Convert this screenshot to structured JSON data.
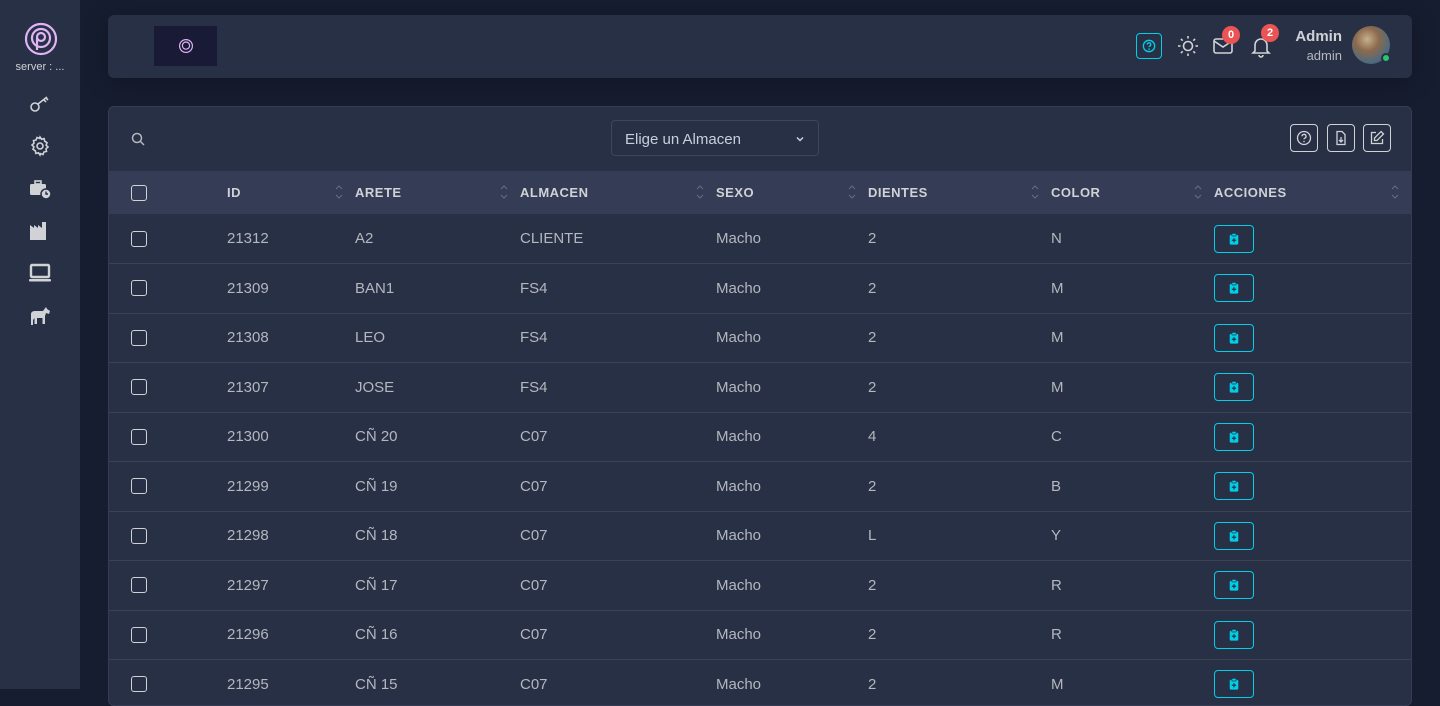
{
  "sidebar": {
    "server_label": "server : ...",
    "icons": [
      "key-icon",
      "gear-icon",
      "briefcase-clock-icon",
      "factory-icon",
      "laptop-icon",
      "horse-icon"
    ]
  },
  "navbar": {
    "mail_count": "0",
    "notification_count": "2",
    "user_name": "Admin",
    "user_role": "admin"
  },
  "filter": {
    "select_value": "Elige un Almacen"
  },
  "table": {
    "headers": [
      "ID",
      "ARETE",
      "ALMACEN",
      "SEXO",
      "DIENTES",
      "COLOR",
      "ACCIONES"
    ],
    "rows": [
      {
        "id": "21312",
        "arete": "A2",
        "almacen": "CLIENTE",
        "sexo": "Macho",
        "dientes": "2",
        "color": "N"
      },
      {
        "id": "21309",
        "arete": "BAN1",
        "almacen": "FS4",
        "sexo": "Macho",
        "dientes": "2",
        "color": "M"
      },
      {
        "id": "21308",
        "arete": "LEO",
        "almacen": "FS4",
        "sexo": "Macho",
        "dientes": "2",
        "color": "M"
      },
      {
        "id": "21307",
        "arete": "JOSE",
        "almacen": "FS4",
        "sexo": "Macho",
        "dientes": "2",
        "color": "M"
      },
      {
        "id": "21300",
        "arete": "CÑ 20",
        "almacen": "C07",
        "sexo": "Macho",
        "dientes": "4",
        "color": "C"
      },
      {
        "id": "21299",
        "arete": "CÑ 19",
        "almacen": "C07",
        "sexo": "Macho",
        "dientes": "2",
        "color": "B"
      },
      {
        "id": "21298",
        "arete": "CÑ 18",
        "almacen": "C07",
        "sexo": "Macho",
        "dientes": "L",
        "color": "Y"
      },
      {
        "id": "21297",
        "arete": "CÑ 17",
        "almacen": "C07",
        "sexo": "Macho",
        "dientes": "2",
        "color": "R"
      },
      {
        "id": "21296",
        "arete": "CÑ 16",
        "almacen": "C07",
        "sexo": "Macho",
        "dientes": "2",
        "color": "R"
      },
      {
        "id": "21295",
        "arete": "CÑ 15",
        "almacen": "C07",
        "sexo": "Macho",
        "dientes": "2",
        "color": "M"
      }
    ]
  },
  "colors": {
    "background": "#161d30",
    "panel": "#283046",
    "header_row": "#343d55",
    "accent": "#00cfe8",
    "badge": "#ea5455",
    "logo": "#e0b3f5",
    "online": "#28c76f"
  }
}
